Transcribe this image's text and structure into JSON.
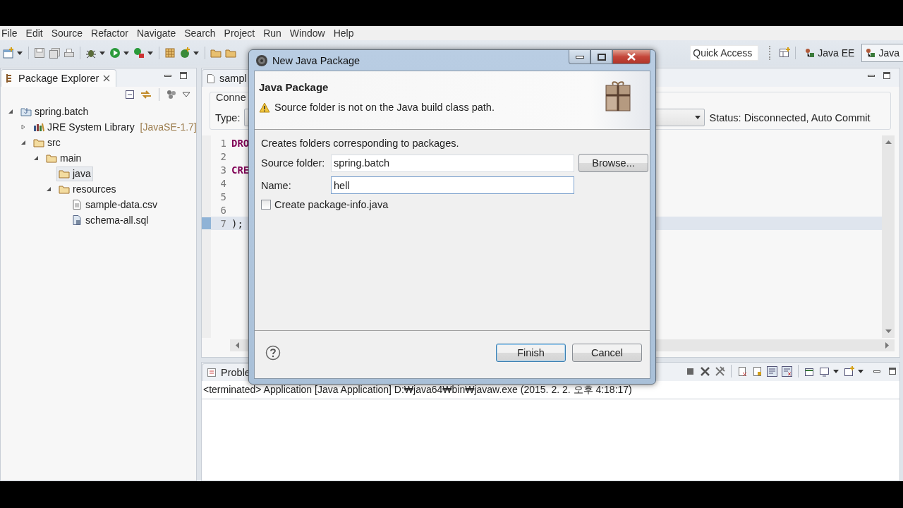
{
  "menu": [
    "File",
    "Edit",
    "Source",
    "Refactor",
    "Navigate",
    "Search",
    "Project",
    "Run",
    "Window",
    "Help"
  ],
  "toolbar": {
    "quick_access": {
      "placeholder": "Quick Access"
    },
    "perspectives": [
      {
        "label": "Java EE",
        "selected": false
      },
      {
        "label": "Java",
        "selected": true
      }
    ]
  },
  "package_explorer": {
    "title": "Package Explorer",
    "tree": [
      {
        "label": "spring.batch",
        "kind": "project",
        "expanded": true,
        "selected": false,
        "children": [
          {
            "label": "JRE System Library",
            "suffix": "[JavaSE-1.7]",
            "kind": "library",
            "expanded": false,
            "selected": false
          },
          {
            "label": "src",
            "kind": "folder",
            "expanded": true,
            "selected": false,
            "children": [
              {
                "label": "main",
                "kind": "folder",
                "expanded": true,
                "selected": false,
                "children": [
                  {
                    "label": "java",
                    "kind": "folder",
                    "selected": true
                  },
                  {
                    "label": "resources",
                    "kind": "folder",
                    "expanded": true,
                    "selected": false,
                    "children": [
                      {
                        "label": "sample-data.csv",
                        "kind": "file",
                        "selected": false
                      },
                      {
                        "label": "schema-all.sql",
                        "kind": "sql",
                        "selected": false
                      }
                    ]
                  }
                ]
              }
            ]
          }
        ]
      }
    ]
  },
  "editor": {
    "tab": "sampl",
    "connection_label": "Conne",
    "type_label": "Type:",
    "status": "Status: Disconnected, Auto Commit",
    "lines": [
      {
        "number": "1",
        "code": "DRO",
        "keyword": true,
        "current": false
      },
      {
        "number": "2",
        "current": false
      },
      {
        "number": "3",
        "code": "CRE",
        "keyword": true,
        "current": false
      },
      {
        "number": "4",
        "current": false
      },
      {
        "number": "5",
        "current": false
      },
      {
        "number": "6",
        "current": false
      },
      {
        "number": "7",
        "code": ");",
        "keyword": false,
        "current": true
      }
    ]
  },
  "console": {
    "tab": "Proble",
    "line": "<terminated> Application [Java Application] D:₩java64₩bin₩javaw.exe (2015. 2. 2. 오후 4:18:17)"
  },
  "dialog": {
    "title": "New Java Package",
    "heading": "Java Package",
    "message": "Source folder is not on the Java build class path.",
    "description": "Creates folders corresponding to packages.",
    "fields": [
      {
        "label": "Source folder:",
        "value": "spring.batch",
        "focused": false
      },
      {
        "label": "Name:",
        "value": "hell",
        "focused": true
      }
    ],
    "browse": "Browse...",
    "checkbox": {
      "label": "Create package-info.java",
      "checked": false
    },
    "buttons": [
      {
        "label": "Finish",
        "default": true
      },
      {
        "label": "Cancel",
        "default": false
      }
    ]
  }
}
